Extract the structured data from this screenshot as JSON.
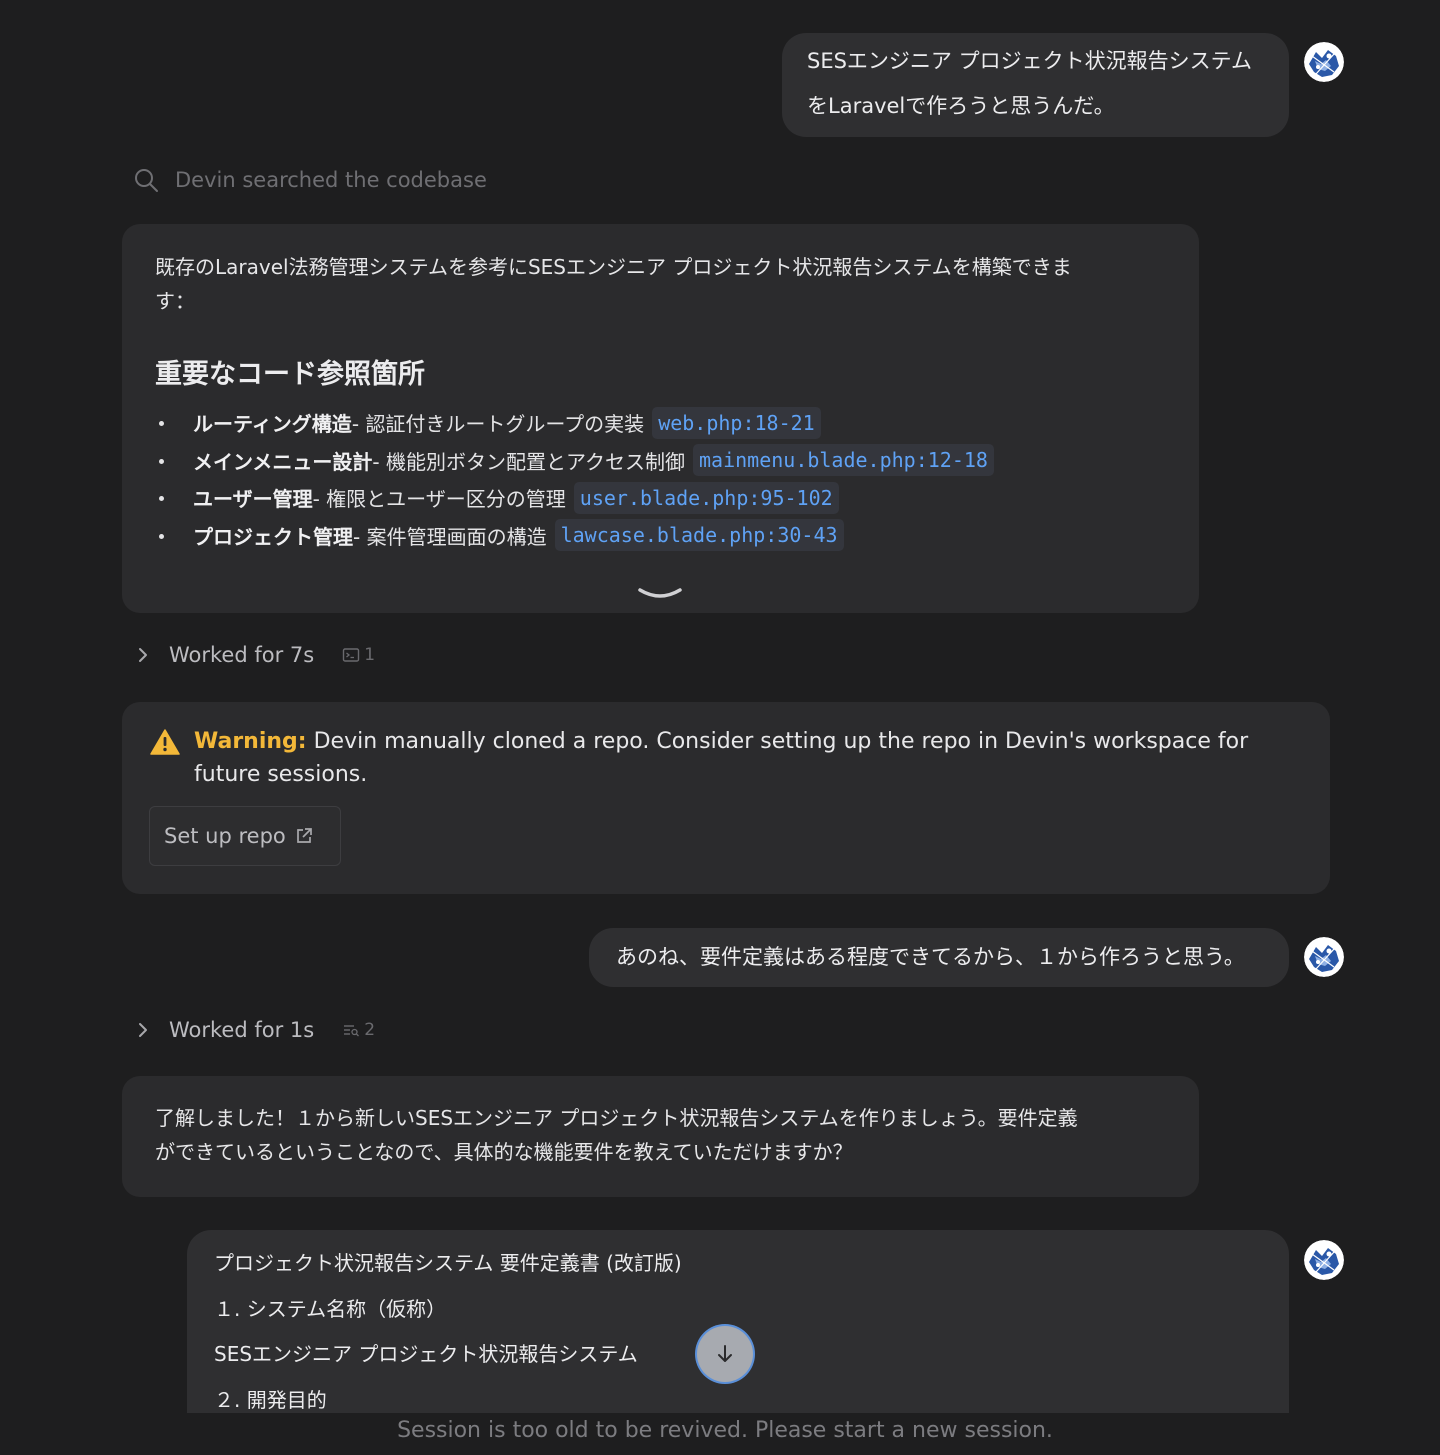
{
  "messages": {
    "user1": {
      "line1": "SESエンジニア プロジェクト状況報告システム",
      "line2": "をLaravelで作ろうと思うんだ。"
    },
    "search_status": "Devin searched the codebase",
    "reply1": {
      "intro_line1": "既存のLaravel法務管理システムを参考にSESエンジニア プロジェクト状況報告システムを構築できま",
      "intro_line2": "す：",
      "heading": "重要なコード参照箇所",
      "refs": [
        {
          "title": "ルーティング構造",
          "desc": " - 認証付きルートグループの実装",
          "code": "web.php:18-21"
        },
        {
          "title": "メインメニュー設計",
          "desc": " - 機能別ボタン配置とアクセス制御",
          "code": "mainmenu.blade.php:12-18"
        },
        {
          "title": "ユーザー管理",
          "desc": " - 権限とユーザー区分の管理",
          "code": "user.blade.php:95-102"
        },
        {
          "title": "プロジェクト管理",
          "desc": " - 案件管理画面の構造",
          "code": "lawcase.blade.php:30-43"
        }
      ]
    },
    "worked1": {
      "label": "Worked for 7s",
      "count": "1"
    },
    "warning": {
      "label": "Warning:",
      "text": " Devin manually cloned a repo. Consider setting up the repo in Devin's workspace for future sessions.",
      "button": "Set up repo"
    },
    "user2": {
      "text": "あのね、要件定義はある程度できてるから、１から作ろうと思う。"
    },
    "worked2": {
      "label": "Worked for 1s",
      "count": "2"
    },
    "reply2": {
      "line1": "了解しました！１から新しいSESエンジニア プロジェクト状況報告システムを作りましょう。要件定義",
      "line2": "ができているということなので、具体的な機能要件を教えていただけますか？"
    },
    "user3": {
      "title": "プロジェクト状況報告システム 要件定義書 (改訂版)",
      "section1": "１. システム名称（仮称）",
      "system_name": "SESエンジニア プロジェクト状況報告システム",
      "section2": "２. 開発目的"
    }
  },
  "footer": {
    "notice": "Session is too old to be revived. Please start a new session."
  },
  "colors": {
    "background": "#1e1e1f",
    "bubble": "#2f2f31",
    "card": "#2b2b2d",
    "code_ref": "#5fa2f5",
    "warning": "#f3b839"
  }
}
